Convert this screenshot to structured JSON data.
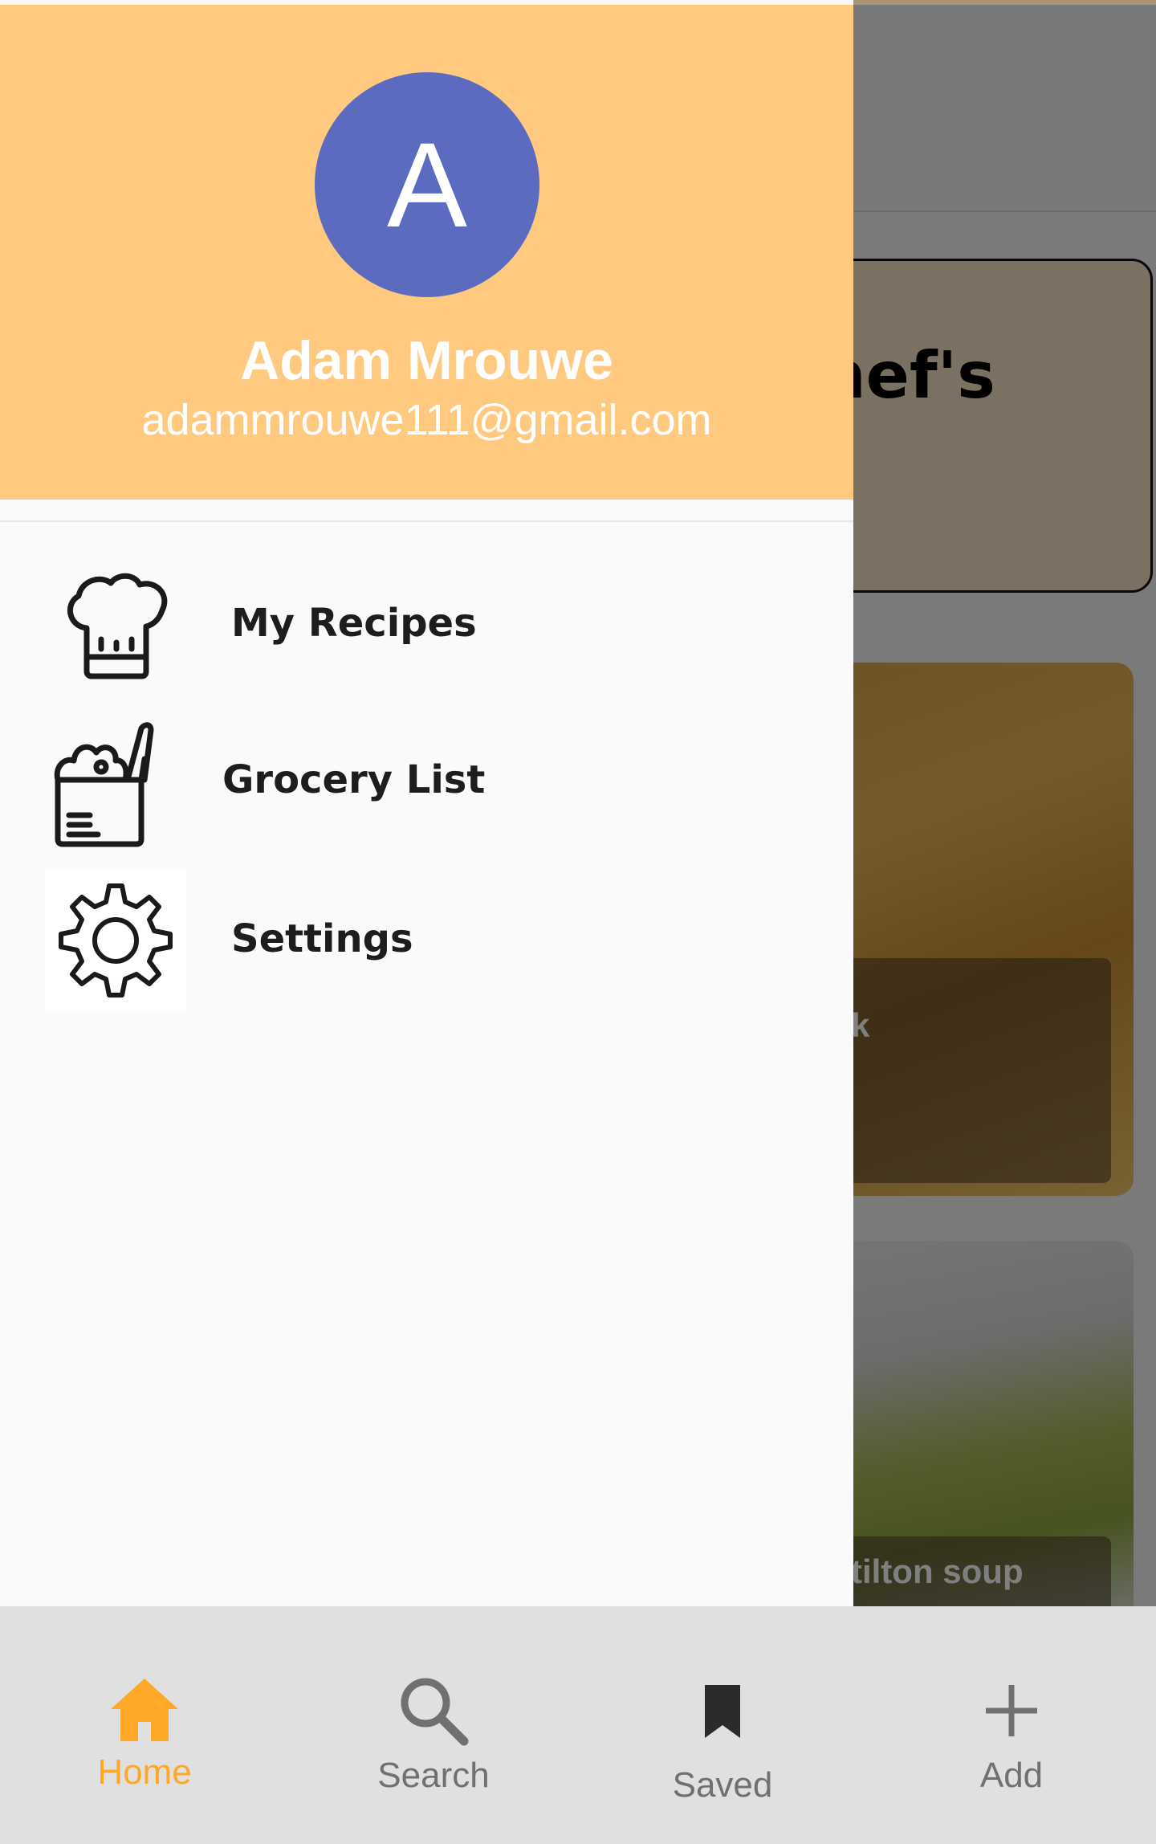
{
  "background": {
    "banner_text": "Chef's",
    "card1_text": "k",
    "card2_text": "tilton soup"
  },
  "drawer": {
    "avatar_letter": "A",
    "user_name": "Adam Mrouwe",
    "user_email": "adammrouwe111@gmail.com",
    "items": [
      {
        "label": "My Recipes",
        "icon": "chef-hat-icon"
      },
      {
        "label": "Grocery List",
        "icon": "grocery-bag-icon"
      },
      {
        "label": "Settings",
        "icon": "gear-icon"
      }
    ]
  },
  "bottom_nav": {
    "items": [
      {
        "label": "Home",
        "icon": "home-icon",
        "active": true
      },
      {
        "label": "Search",
        "icon": "search-icon",
        "active": false
      },
      {
        "label": "Saved",
        "icon": "bookmark-icon",
        "active": false
      },
      {
        "label": "Add",
        "icon": "plus-icon",
        "active": false
      }
    ]
  },
  "colors": {
    "header_bg": "#ffca80",
    "avatar_bg": "#5c6bc0",
    "active_nav": "#ffa726",
    "inactive_nav": "#707070"
  }
}
